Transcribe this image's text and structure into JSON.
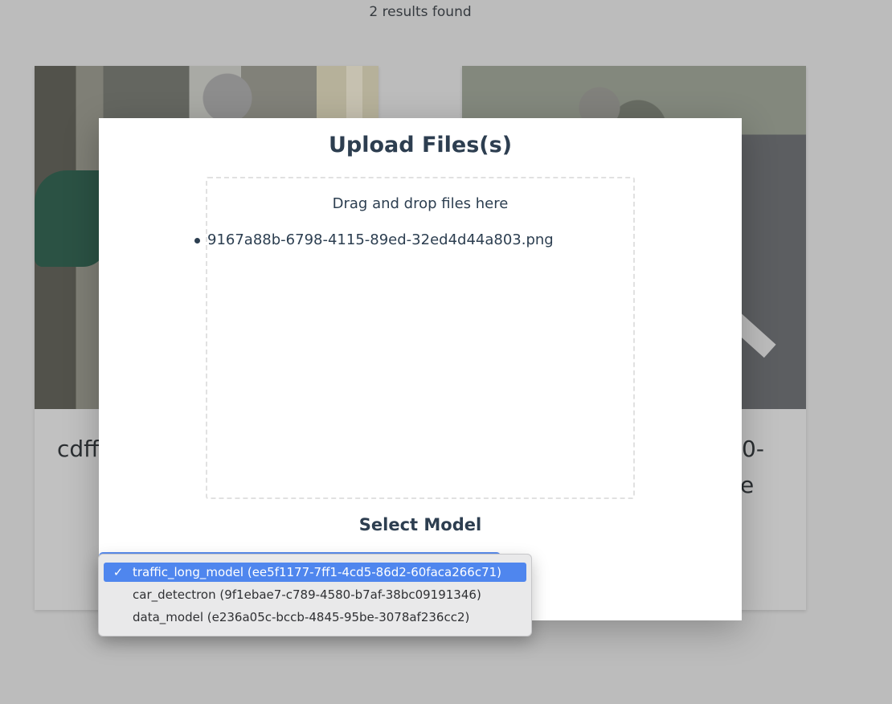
{
  "page": {
    "results_count": "2 results found"
  },
  "cards": [
    {
      "title_visible": "cdff"
    },
    {
      "title_visible_line1": "0-",
      "title_visible_line2": "e"
    }
  ],
  "modal": {
    "title": "Upload Files(s)",
    "dropzone_hint": "Drag and drop files here",
    "files": [
      "9167a88b-6798-4115-89ed-32ed4d44a803.png"
    ],
    "select_label": "Select Model"
  },
  "dropdown": {
    "options": [
      {
        "check": "✓",
        "label": "traffic_long_model (ee5f1177-7ff1-4cd5-86d2-60faca266c71)",
        "selected": true
      },
      {
        "check": "",
        "label": "car_detectron (9f1ebae7-c789-4580-b7af-38bc09191346)",
        "selected": false
      },
      {
        "check": "",
        "label": "data_model (e236a05c-bccb-4845-95be-3078af236cc2)",
        "selected": false
      }
    ]
  }
}
